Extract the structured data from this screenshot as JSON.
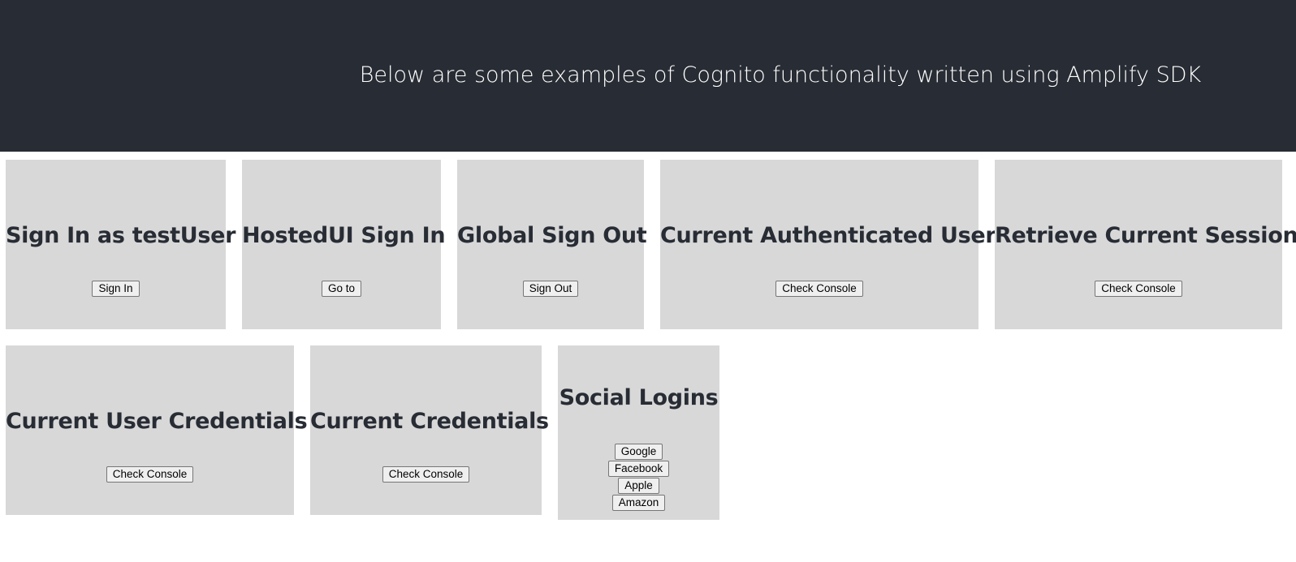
{
  "header": {
    "text": "Below are some examples of Cognito functionality written using Amplify SDK"
  },
  "cards": [
    {
      "title": "Sign In as testUser",
      "buttons": [
        "Sign In"
      ]
    },
    {
      "title": "HostedUI Sign In",
      "buttons": [
        "Go to"
      ]
    },
    {
      "title": "Global Sign Out",
      "buttons": [
        "Sign Out"
      ]
    },
    {
      "title": "Current Authenticated User",
      "buttons": [
        "Check Console"
      ]
    },
    {
      "title": "Retrieve Current Session",
      "buttons": [
        "Check Console"
      ]
    },
    {
      "title": "Current User Credentials",
      "buttons": [
        "Check Console"
      ]
    },
    {
      "title": "Current Credentials",
      "buttons": [
        "Check Console"
      ]
    },
    {
      "title": "Social Logins",
      "buttons": [
        "Google",
        "Facebook",
        "Apple",
        "Amazon"
      ]
    }
  ],
  "colors": {
    "header_bg": "#282c34",
    "card_bg": "#d8d8d8",
    "title_text": "#282c34"
  }
}
